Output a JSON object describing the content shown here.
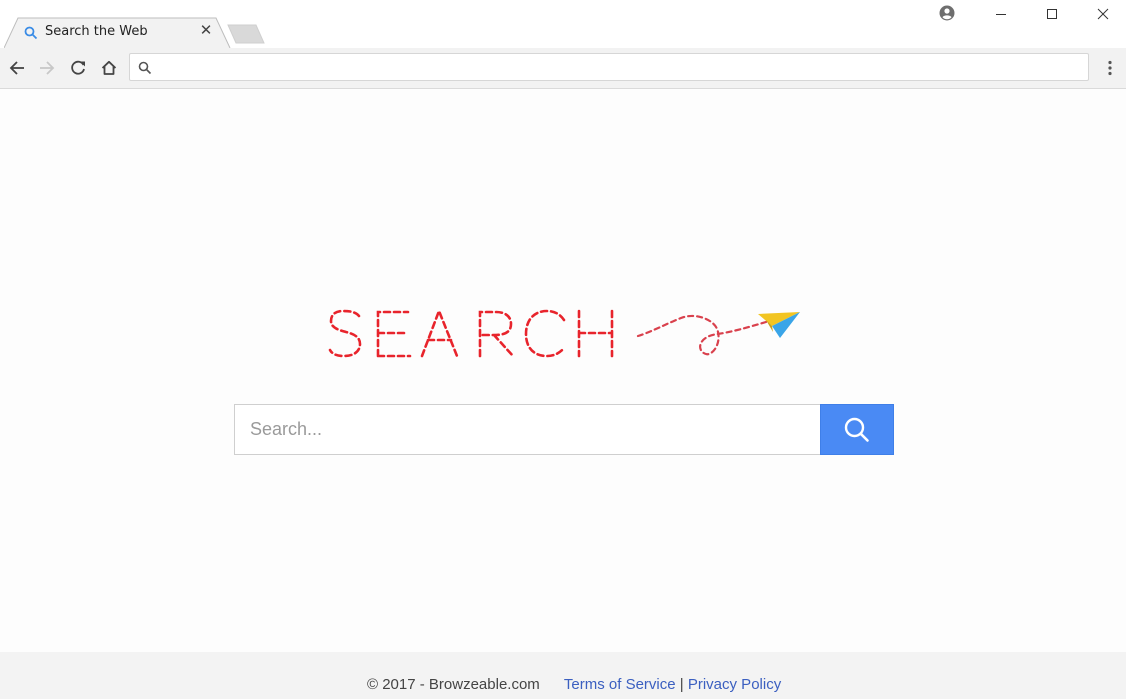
{
  "browser": {
    "tab": {
      "title": "Search the Web",
      "icon": "search-icon",
      "close_icon": "close-icon"
    },
    "window_controls": {
      "profile_icon": "account-circle-icon",
      "minimize_icon": "minimize-icon",
      "maximize_icon": "maximize-icon",
      "close_icon": "close-icon"
    },
    "toolbar": {
      "back_icon": "arrow-left-icon",
      "forward_icon": "arrow-right-icon",
      "reload_icon": "reload-icon",
      "home_icon": "home-icon",
      "omnibox_value": "",
      "menu_icon": "more-vertical-icon"
    }
  },
  "page": {
    "logo_text": "SEARCH",
    "logo_color": "#e8242c",
    "search": {
      "placeholder": "Search...",
      "value": "",
      "button_icon": "search-icon",
      "button_color": "#4a8af4"
    },
    "footer": {
      "copyright": "© 2017 - Browzeable.com",
      "terms_label": "Terms of Service",
      "separator": "|",
      "privacy_label": "Privacy Policy",
      "link_color": "#3b5fc0"
    }
  }
}
